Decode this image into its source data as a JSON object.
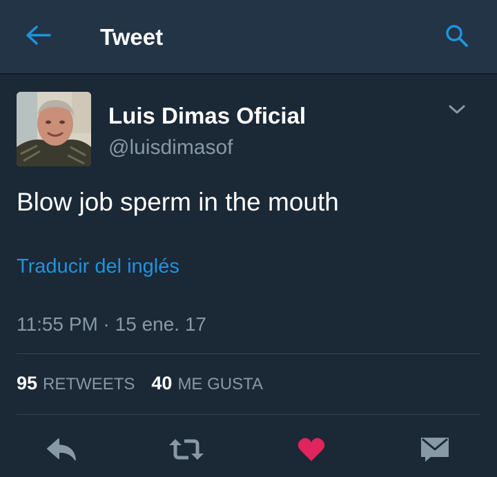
{
  "header": {
    "title": "Tweet",
    "back_icon": "arrow-left-icon",
    "search_icon": "search-icon"
  },
  "tweet": {
    "display_name": "Luis Dimas Oficial",
    "handle": "@luisdimasof",
    "text": "Blow job sperm in the mouth",
    "translate_label": "Traducir del inglés",
    "timestamp": "11:55 PM · 15 ene. 17",
    "retweet_count": "95",
    "retweet_label": "RETWEETS",
    "like_count": "40",
    "like_label": "ME GUSTA"
  },
  "actions": {
    "reply_icon": "reply-icon",
    "retweet_icon": "retweet-icon",
    "like_icon": "heart-icon",
    "dm_icon": "envelope-icon"
  },
  "colors": {
    "background": "#1b2836",
    "header": "#243447",
    "accent": "#1b95e0",
    "like": "#e0245e",
    "muted": "#8899a6"
  }
}
